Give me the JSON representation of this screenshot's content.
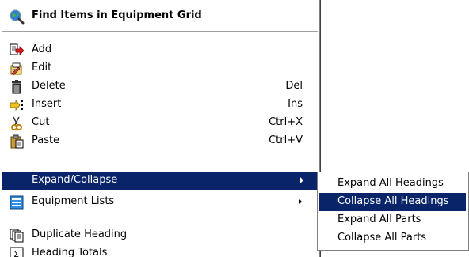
{
  "menu": {
    "header": {
      "title": "Find Items in Equipment Grid",
      "icon": "search-globe-icon"
    },
    "items": [
      {
        "label": "Add",
        "shortcut": "",
        "icon": "add-arrow-icon"
      },
      {
        "label": "Edit",
        "shortcut": "",
        "icon": "edit-icon"
      },
      {
        "label": "Delete",
        "shortcut": "Del",
        "icon": "trash-icon"
      },
      {
        "label": "Insert",
        "shortcut": "Ins",
        "icon": "insert-icon"
      },
      {
        "label": "Cut",
        "shortcut": "Ctrl+X",
        "icon": "scissors-icon"
      },
      {
        "label": "Paste",
        "shortcut": "Ctrl+V",
        "icon": "clipboard-icon"
      },
      {
        "label": "Expand/Collapse",
        "shortcut": "",
        "icon": "",
        "submenu": true
      },
      {
        "label": "Equipment Lists",
        "shortcut": "",
        "icon": "list-icon",
        "submenu": true
      },
      {
        "label": "Duplicate Heading",
        "shortcut": "",
        "icon": "duplicate-icon"
      },
      {
        "label": "Heading Totals",
        "shortcut": "",
        "icon": "totals-icon"
      }
    ]
  },
  "submenu": {
    "items": [
      {
        "label": "Expand All Headings"
      },
      {
        "label": "Collapse All Headings"
      },
      {
        "label": "Expand All Parts"
      },
      {
        "label": "Collapse All Parts"
      }
    ]
  },
  "colors": {
    "highlight": "#0a246a",
    "separator": "#a0a0a0"
  }
}
